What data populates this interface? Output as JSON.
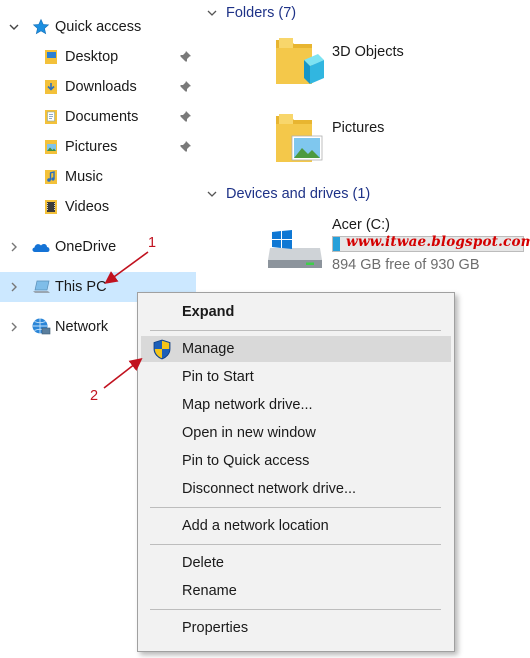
{
  "nav": {
    "quick_access": "Quick access",
    "items": [
      {
        "label": "Desktop",
        "pinned": true
      },
      {
        "label": "Downloads",
        "pinned": true
      },
      {
        "label": "Documents",
        "pinned": true
      },
      {
        "label": "Pictures",
        "pinned": true
      },
      {
        "label": "Music",
        "pinned": false
      },
      {
        "label": "Videos",
        "pinned": false
      }
    ],
    "onedrive": "OneDrive",
    "this_pc": "This PC",
    "network": "Network"
  },
  "content": {
    "folders_header": "Folders (7)",
    "folders": [
      {
        "label": "3D Objects"
      },
      {
        "label": "Pictures"
      }
    ],
    "devices_header": "Devices and drives (1)",
    "drive": {
      "label": "Acer (C:)",
      "free_text": "894 GB free of 930 GB",
      "used_fraction": 0.039
    }
  },
  "watermark": "www.itwae.blogspot.com",
  "menu": {
    "items": [
      {
        "label": "Expand",
        "bold": true
      },
      {
        "label": "Manage",
        "hover": true,
        "shield": true
      },
      {
        "label": "Pin to Start"
      },
      {
        "label": "Map network drive..."
      },
      {
        "label": "Open in new window"
      },
      {
        "label": "Pin to Quick access"
      },
      {
        "label": "Disconnect network drive..."
      },
      {
        "label": "Add a network location"
      },
      {
        "label": "Delete"
      },
      {
        "label": "Rename"
      },
      {
        "label": "Properties"
      }
    ]
  },
  "annotations": {
    "step1": "1",
    "step2": "2",
    "color": "#c1121f"
  },
  "colors": {
    "accent": "#1e3287",
    "selection": "#cce8ff",
    "drive_bar": "#26a0da"
  }
}
